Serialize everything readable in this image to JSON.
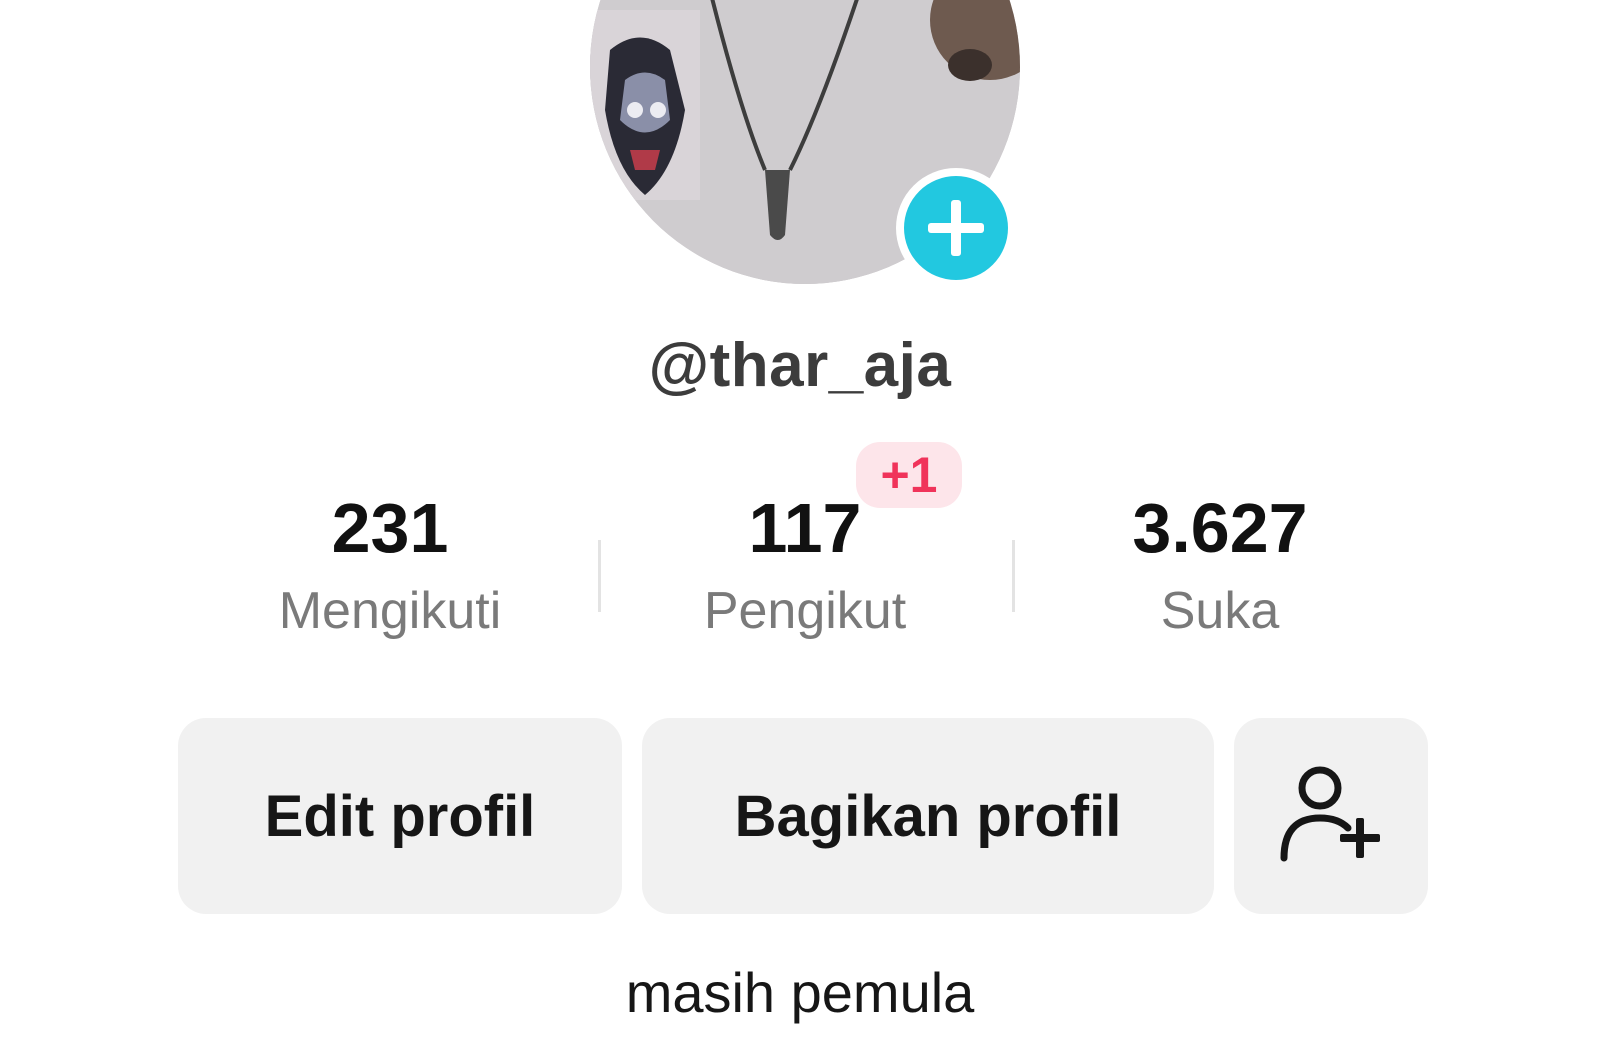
{
  "profile": {
    "username": "@thar_aja",
    "bio": "masih pemula"
  },
  "stats": {
    "following": {
      "value": "231",
      "label": "Mengikuti"
    },
    "followers": {
      "value": "117",
      "label": "Pengikut",
      "new_badge": "+1"
    },
    "likes": {
      "value": "3.627",
      "label": "Suka"
    }
  },
  "actions": {
    "edit_label": "Edit profil",
    "share_label": "Bagikan profil",
    "add_friend_icon": "person-plus-icon"
  },
  "icons": {
    "avatar_add": "plus-icon"
  },
  "colors": {
    "accent": "#22c8e0",
    "badge_text": "#f0335a",
    "badge_bg": "#fde5ea",
    "button_bg": "#f1f1f1"
  }
}
